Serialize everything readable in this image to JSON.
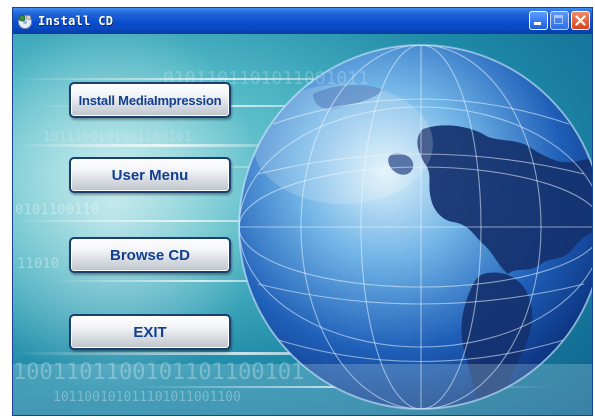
{
  "window": {
    "title": "Install CD",
    "icon": "cd-setup-icon",
    "controls": {
      "minimize": "minimize-icon",
      "maximize": "maximize-icon",
      "close": "close-icon"
    }
  },
  "menu": {
    "install_label": "Install MediaImpression",
    "user_menu_label": "User Menu",
    "browse_label": "Browse CD",
    "exit_label": "EXIT"
  },
  "background": {
    "digits": [
      "0101101101011001011",
      "1011100101001100101",
      "0101100110",
      "11010 1001",
      "1001101100101101100101",
      "101100101011101011001100"
    ]
  },
  "colors": {
    "titlebar": "#0a4fd0",
    "button_text": "#123f8f",
    "button_border": "#1b3f6e",
    "background": "#4fb6c4"
  }
}
